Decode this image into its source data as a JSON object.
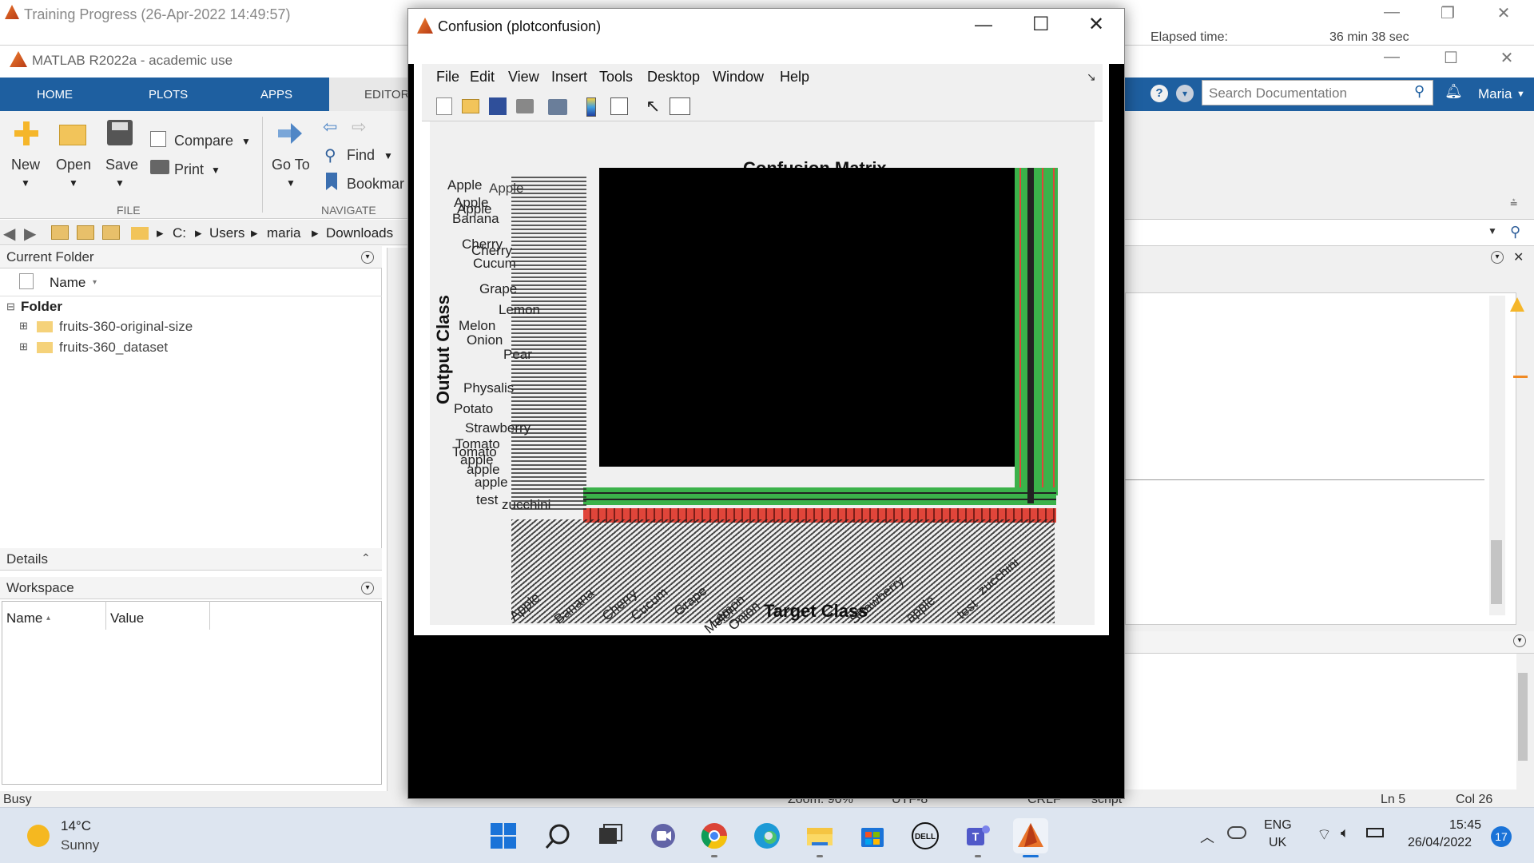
{
  "training_window": {
    "title": "Training Progress (26-Apr-2022 14:49:57)",
    "elapsed_label": "Elapsed time:",
    "elapsed_value": "36 min 38 sec"
  },
  "matlab": {
    "title": "MATLAB R2022a - academic use",
    "tabs": [
      "HOME",
      "PLOTS",
      "APPS",
      "EDITOR"
    ],
    "toolstrip": {
      "new": "New",
      "open": "Open",
      "save": "Save",
      "compare": "Compare",
      "print": "Print",
      "goto": "Go To",
      "find": "Find",
      "bookmark": "Bookmar",
      "file_group": "FILE",
      "navigate_group": "NAVIGATE"
    },
    "address": {
      "path": [
        "C:",
        "Users",
        "maria",
        "Downloads"
      ]
    },
    "current_folder": {
      "title": "Current Folder",
      "name_header": "Name",
      "folder_label": "Folder",
      "items": [
        "fruits-360-original-size",
        "fruits-360_dataset"
      ]
    },
    "details_title": "Details",
    "workspace": {
      "title": "Workspace",
      "col_name": "Name",
      "col_value": "Value"
    },
    "search_placeholder": "Search Documentation",
    "user": "Maria",
    "status": {
      "busy": "Busy",
      "zoom": "Zoom: 90%",
      "encoding": "UTF-8",
      "eol": "CRLF",
      "mode": "script",
      "ln": "Ln  5",
      "col": "Col  26"
    }
  },
  "figure": {
    "title": "Confusion (plotconfusion)",
    "menu": [
      "File",
      "Edit",
      "View",
      "Insert",
      "Tools",
      "Desktop",
      "Window",
      "Help"
    ],
    "plot_title": "Confusion Matrix",
    "ylabel": "Output Class",
    "xlabel": "Target Class",
    "visible_class_labels": [
      "Apple",
      "Banana",
      "Cherry",
      "Cucum",
      "Grape",
      "Lemon",
      "Melon",
      "Onion",
      "Pear",
      "Physalis",
      "Potato",
      "Strawberry",
      "Tomato",
      "apple",
      "test",
      "zucchini"
    ]
  },
  "taskbar": {
    "weather_temp": "14°C",
    "weather_desc": "Sunny",
    "lang1": "ENG",
    "lang2": "UK",
    "time": "15:45",
    "date": "26/04/2022",
    "notif_count": "17"
  },
  "colors": {
    "matlab_blue": "#1e5fa0",
    "cm_green": "#3bb24a",
    "cm_red": "#e0453a",
    "taskbar_bg": "#dde5f0"
  }
}
